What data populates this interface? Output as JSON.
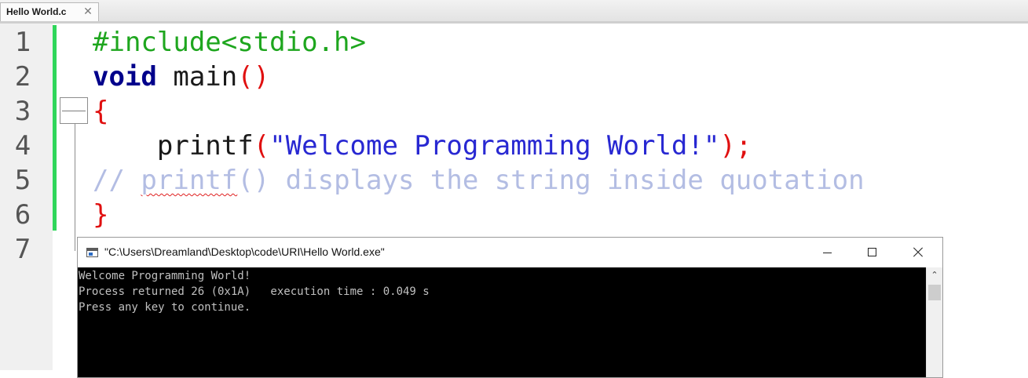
{
  "tab": {
    "label": "Hello World.c",
    "close_glyph": "✕"
  },
  "editor": {
    "line_numbers": [
      "1",
      "2",
      "3",
      "4",
      "5",
      "6",
      "7"
    ],
    "lines": [
      {
        "tokens": [
          {
            "t": "#include<stdio.h>",
            "c": "pp"
          }
        ]
      },
      {
        "tokens": [
          {
            "t": "void",
            "c": "kw"
          },
          {
            "t": " main",
            "c": "fn"
          },
          {
            "t": "()",
            "c": "par"
          }
        ]
      },
      {
        "tokens": [
          {
            "t": "{",
            "c": "par"
          }
        ]
      },
      {
        "tokens": [
          {
            "t": "    printf",
            "c": "fn"
          },
          {
            "t": "(",
            "c": "par"
          },
          {
            "t": "\"Welcome Programming World!\"",
            "c": "str"
          },
          {
            "t": ");",
            "c": "par"
          }
        ]
      },
      {
        "tokens": [
          {
            "t": "// ",
            "c": "cmt"
          },
          {
            "t": "printf",
            "c": "cmt squig"
          },
          {
            "t": "() displays the string inside quotation",
            "c": "cmt"
          }
        ]
      },
      {
        "tokens": [
          {
            "t": "}",
            "c": "par"
          }
        ]
      },
      {
        "tokens": []
      }
    ]
  },
  "console": {
    "title": "\"C:\\Users\\Dreamland\\Desktop\\code\\URI\\Hello World.exe\"",
    "output_lines": [
      "Welcome Programming World!",
      "Process returned 26 (0x1A)   execution time : 0.049 s",
      "Press any key to continue."
    ]
  },
  "colors": {
    "preprocessor": "#1ea61e",
    "keyword": "#00008b",
    "paren": "#e01010",
    "string": "#2828d2",
    "comment": "#b3bde3",
    "change_bar": "#2fd65a"
  }
}
